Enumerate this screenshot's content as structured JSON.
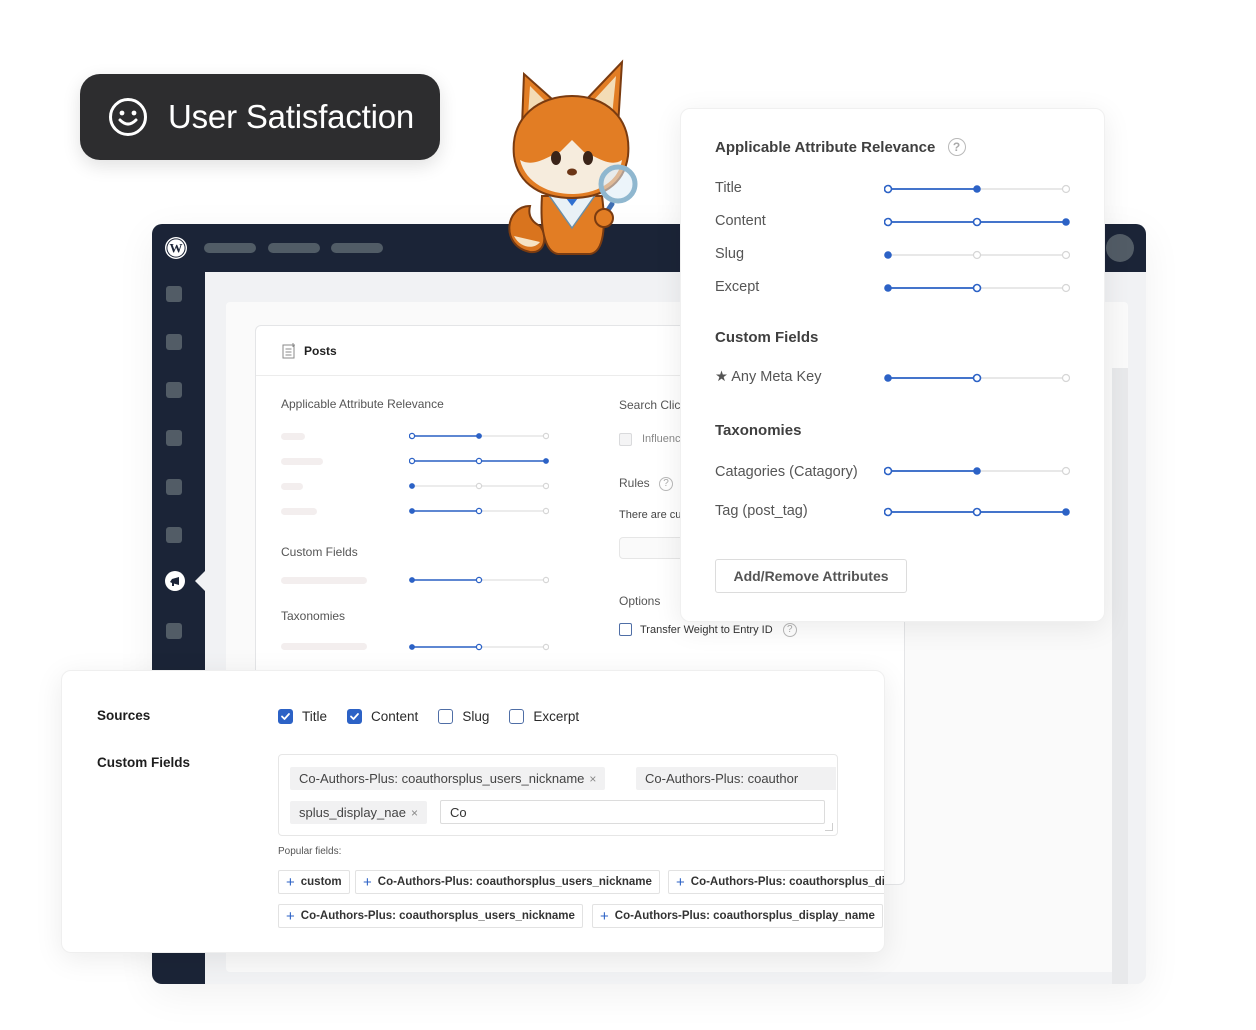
{
  "badge": {
    "label": "User Satisfaction",
    "icon": "smiley-face-icon"
  },
  "mascot": {
    "name": "fox-mascot-with-magnifier"
  },
  "wp_admin": {
    "logo": "wordpress-logo-icon",
    "active_menu_icon": "megaphone-icon"
  },
  "posts_card": {
    "title": "Posts",
    "icon": "document-icon",
    "relevance_title": "Applicable Attribute Relevance",
    "custom_fields_title": "Custom Fields",
    "taxonomies_title": "Taxonomies",
    "sliders": [
      {
        "value": 2,
        "max": 3,
        "track_to": 2
      },
      {
        "value": 3,
        "max": 3,
        "track_to": 3
      },
      {
        "value": 1,
        "max": 3,
        "track_to": 1
      },
      {
        "value": 1,
        "max": 3,
        "track_to": 2
      },
      {
        "value": 1,
        "max": 3,
        "track_to": 2
      },
      {
        "value": 1,
        "max": 3,
        "track_to": 2
      }
    ],
    "search_clicks_label": "Search Clic",
    "influence_label": "Influenc",
    "rules_label": "Rules",
    "rules_text": "There are cu",
    "options_label": "Options",
    "transfer_weight_label": "Transfer Weight to Entry ID"
  },
  "relevance_panel": {
    "title": "Applicable Attribute Relevance",
    "attributes": [
      {
        "label": "Title",
        "value": 2,
        "track_to": 2
      },
      {
        "label": "Content",
        "value": 3,
        "track_to": 3
      },
      {
        "label": "Slug",
        "value": 1,
        "track_to": 1
      },
      {
        "label": "Except",
        "value": 1,
        "track_to": 2
      }
    ],
    "custom_fields_title": "Custom Fields",
    "custom_fields": [
      {
        "label": "★ Any Meta Key",
        "value": 1,
        "track_to": 2
      }
    ],
    "taxonomies_title": "Taxonomies",
    "taxonomies": [
      {
        "label": "Catagories (Catagory)",
        "value": 2,
        "track_to": 2
      },
      {
        "label": "Tag (post_tag)",
        "value": 3,
        "track_to": 3
      }
    ],
    "add_remove_button": "Add/Remove Attributes",
    "accent_color": "#2c62c6"
  },
  "sources_panel": {
    "sources_label": "Sources",
    "sources": [
      {
        "label": "Title",
        "checked": true
      },
      {
        "label": "Content",
        "checked": true
      },
      {
        "label": "Slug",
        "checked": false
      },
      {
        "label": "Excerpt",
        "checked": false
      }
    ],
    "custom_fields_label": "Custom Fields",
    "selected_tags": [
      "Co-Authors-Plus: coauthorsplus_users_nickname",
      "Co-Authors-Plus: coauthor",
      "splus_display_nae"
    ],
    "tag_input_value": "Co",
    "popular_label": "Popular fields:",
    "popular_fields": [
      "custom",
      "Co-Authors-Plus: coauthorsplus_users_nickname",
      "Co-Authors-Plus: coauthorsplus_di",
      "Co-Authors-Plus: coauthorsplus_users_nickname",
      "Co-Authors-Plus: coauthorsplus_display_name"
    ]
  }
}
